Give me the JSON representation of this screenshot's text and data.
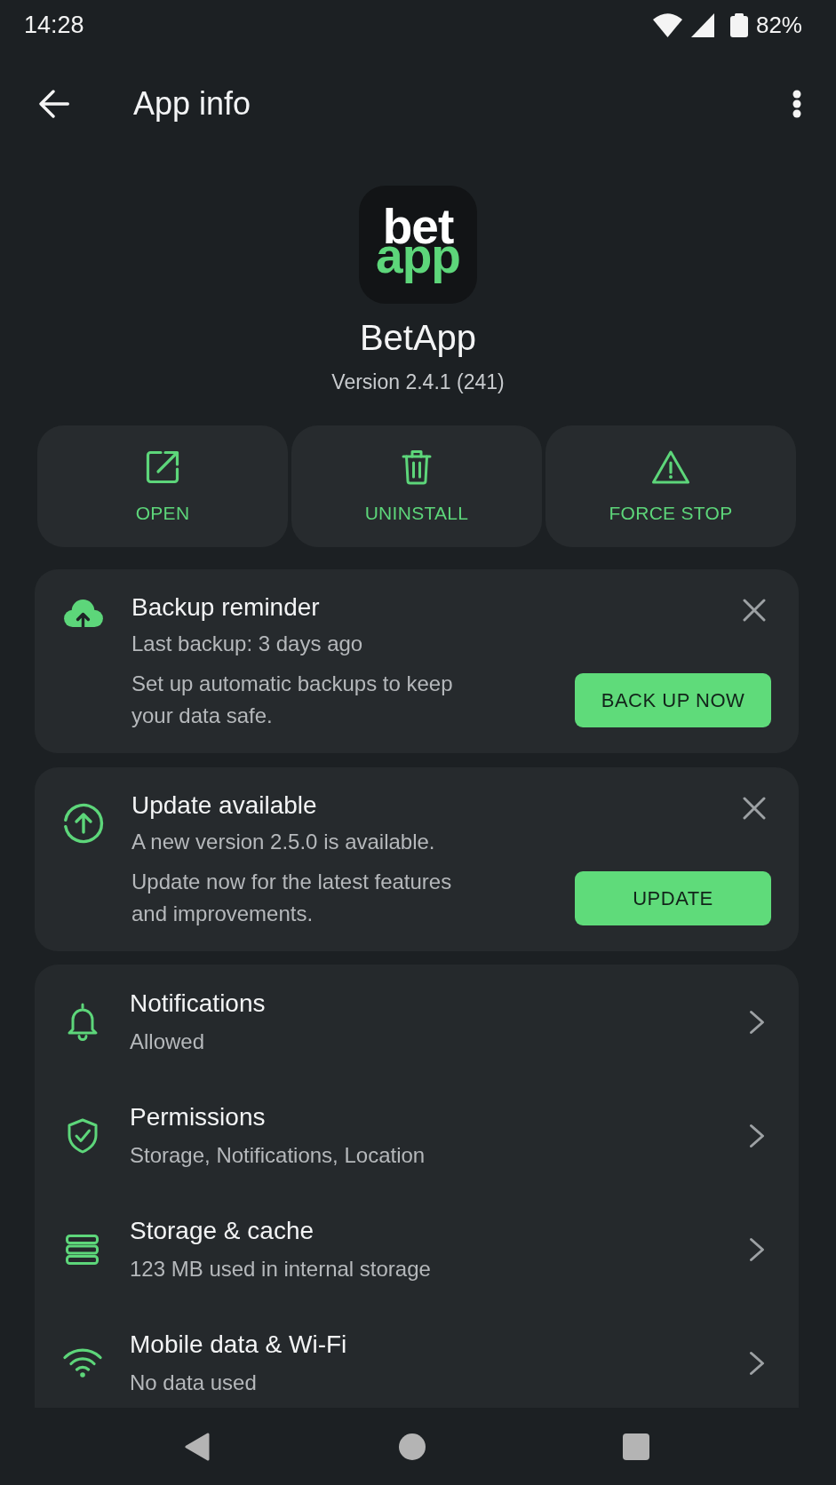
{
  "status_bar": {
    "time": "14:28",
    "battery": "82%"
  },
  "app_bar": {
    "title": "App info"
  },
  "app": {
    "logo": [
      "bet",
      "app"
    ],
    "name": "BetApp",
    "version": "Version 2.4.1 (241)"
  },
  "actions": [
    {
      "label": "OPEN"
    },
    {
      "label": "UNINSTALL"
    },
    {
      "label": "FORCE STOP"
    }
  ],
  "notices": [
    {
      "title": "Backup reminder",
      "subtitle": "Last backup: 3 days ago",
      "body": "Set up automatic backups to keep your data safe.",
      "button": "BACK UP NOW"
    },
    {
      "title": "Update available",
      "subtitle": "A new version 2.5.0 is available.",
      "body": "Update now for the latest features and improvements.",
      "button": "UPDATE"
    }
  ],
  "settings": [
    {
      "title": "Notifications",
      "summary": "Allowed"
    },
    {
      "title": "Permissions",
      "summary": "Storage, Notifications, Location"
    },
    {
      "title": "Storage & cache",
      "summary": "123 MB used in internal storage"
    },
    {
      "title": "Mobile data & Wi-Fi",
      "summary": "No data used"
    }
  ]
}
